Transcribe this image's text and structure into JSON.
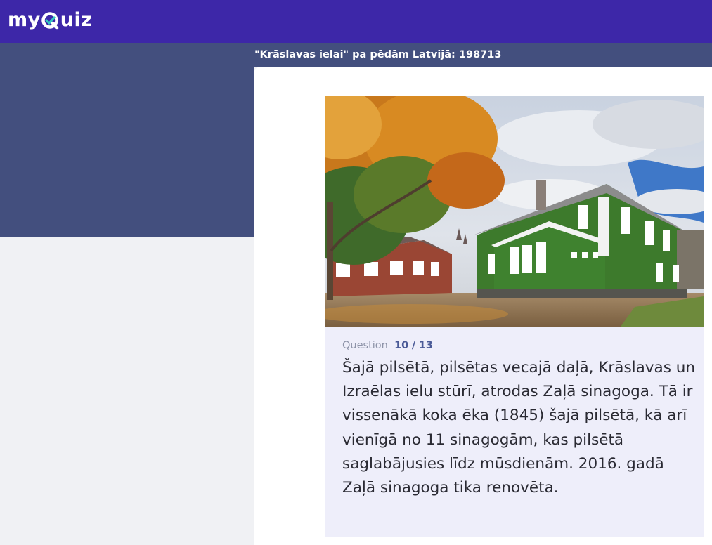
{
  "header": {
    "logo_prefix": "my",
    "logo_suffix": "uiz",
    "logo_q_icon": "q-checkmark-icon",
    "brand_color": "#3d27a8"
  },
  "quiz": {
    "title": "\"Krāslavas ielai\" pa pēdām Latvijā: 198713"
  },
  "question": {
    "label": "Question",
    "current": "10",
    "separator": "/",
    "total": "13",
    "text": "Šajā pilsētā, pilsētas vecajā daļā, Krāslavas un Izraēlas ielu stūrī, atrodas Zaļā sinagoga. Tā ir vissenākā koka ēka (1845) šajā pilsētā, kā arī vienīgā no 11 sinagogām, kas pilsētā saglabājusies līdz mūsdienām. 2016. gadā Zaļā sinagoga tika renovēta."
  },
  "photo": {
    "subject": "green-wooden-synagogue-photo"
  },
  "colors": {
    "subbar": "#434f7e",
    "question_box": "#eeeefa",
    "counter_accent": "#4a5a97"
  }
}
